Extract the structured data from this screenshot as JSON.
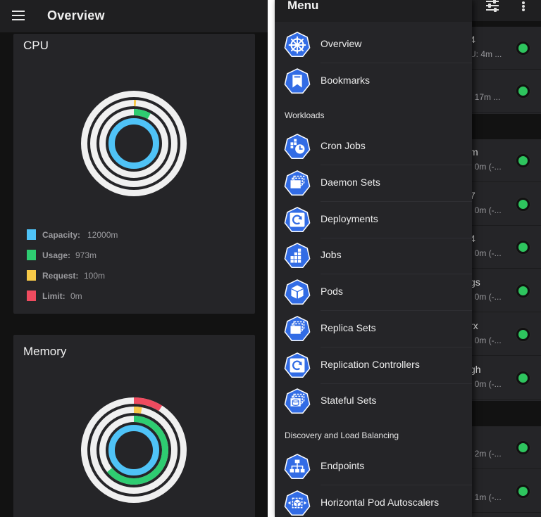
{
  "left": {
    "title": "Overview",
    "cpu": {
      "title": "CPU",
      "legend": [
        {
          "label": "Capacity:",
          "value": "12000m",
          "color": "#4fc3f7"
        },
        {
          "label": "Usage:",
          "value": "973m",
          "color": "#2ecc71"
        },
        {
          "label": "Request:",
          "value": "100m",
          "color": "#f7c948"
        },
        {
          "label": "Limit:",
          "value": "0m",
          "color": "#ef4b5f"
        }
      ],
      "rings": {
        "usage": 0.081,
        "request": 0.0083,
        "limit": 0.0
      }
    },
    "memory": {
      "title": "Memory",
      "rings": {
        "usage": 0.64,
        "request": 0.03,
        "limit": 0.09
      }
    }
  },
  "drawer": {
    "title": "Menu",
    "items_top": [
      {
        "label": "Overview",
        "icon": "helm-wheel-icon"
      },
      {
        "label": "Bookmarks",
        "icon": "bookmark-icon"
      }
    ],
    "section_workloads": "Workloads",
    "workloads": [
      {
        "label": "Cron Jobs",
        "icon": "cron-job-icon"
      },
      {
        "label": "Daemon Sets",
        "icon": "daemon-set-icon"
      },
      {
        "label": "Deployments",
        "icon": "deployment-icon"
      },
      {
        "label": "Jobs",
        "icon": "job-icon"
      },
      {
        "label": "Pods",
        "icon": "pod-icon"
      },
      {
        "label": "Replica Sets",
        "icon": "replica-set-icon"
      },
      {
        "label": "Replication Controllers",
        "icon": "replication-controller-icon"
      },
      {
        "label": "Stateful Sets",
        "icon": "stateful-set-icon"
      }
    ],
    "section_discovery": "Discovery and Load Balancing",
    "discovery": [
      {
        "label": "Endpoints",
        "icon": "endpoints-icon"
      },
      {
        "label": "Horizontal Pod Autoscalers",
        "icon": "hpa-icon"
      }
    ]
  },
  "background_rows": [
    {
      "name": "4",
      "meta": "U: 4m ..."
    },
    {
      "name": "",
      "meta": ": 17m ..."
    },
    {
      "name": "m",
      "meta": ": 0m (-..."
    },
    {
      "name": "7",
      "meta": ": 0m (-..."
    },
    {
      "name": "4",
      "meta": ": 0m (-..."
    },
    {
      "name": "gs",
      "meta": ": 0m (-..."
    },
    {
      "name": "rx",
      "meta": ": 0m (-..."
    },
    {
      "name": "gh",
      "meta": ": 0m (-..."
    },
    {
      "name": "",
      "meta": ": 2m (-..."
    },
    {
      "name": "",
      "meta": ": 1m (-..."
    }
  ],
  "colors": {
    "accent_blue": "#326ce5",
    "status_ok": "#2ec55e",
    "track": "#f0f0f0"
  }
}
